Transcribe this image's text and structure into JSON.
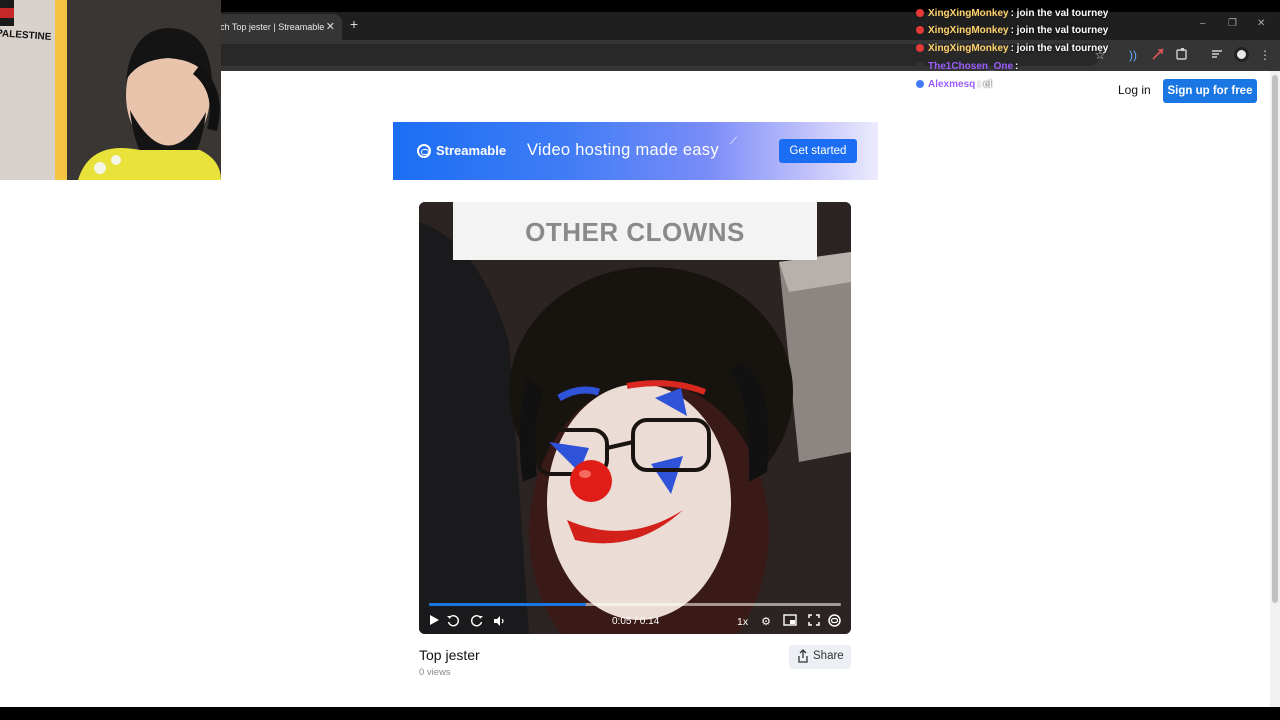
{
  "browser": {
    "tab_title": "ch Top jester | Streamable",
    "tab_close_glyph": "✕",
    "new_tab_glyph": "+",
    "window_controls": [
      "–",
      "❐",
      "✕"
    ],
    "toolbar_icons": [
      "star-icon",
      "audio-icon",
      "extension-puzzle-icon",
      "extension-icon",
      "tab-search-icon",
      "profile-avatar",
      "kebab-menu-icon"
    ]
  },
  "header": {
    "login_label": "Log in",
    "signup_label": "Sign up for free",
    "accent_color": "#1976e3"
  },
  "banner": {
    "brand": "Streamable",
    "tagline": "Video hosting made easy",
    "cta": "Get started"
  },
  "video": {
    "caption": "OTHER CLOWNS",
    "time_display": "0:05 / 0:14",
    "progress_fraction": 0.38,
    "speed": "1x",
    "title": "Top jester",
    "views": "0 views",
    "share_label": "Share"
  },
  "webcam": {
    "sign_text": "PALESTINE"
  },
  "chat": {
    "messages": [
      {
        "user": "XingXingMonkey",
        "text": ": join the val tourney",
        "color": "#ffd36b",
        "badge": "#e53935"
      },
      {
        "user": "XingXingMonkey",
        "text": ": join the val tourney",
        "color": "#ffd36b",
        "badge": "#e53935"
      },
      {
        "user": "XingXingMonkey",
        "text": ": join the val tourney",
        "color": "#ffd36b",
        "badge": "#e53935"
      },
      {
        "user": "The1Chosen_One",
        "text": ":",
        "color": "#9b5cff",
        "badge": "#333333"
      },
      {
        "user": "Alexmesq",
        "text": ": el",
        "color": "#9b5cff",
        "badge": "#3f7cf6"
      }
    ]
  }
}
